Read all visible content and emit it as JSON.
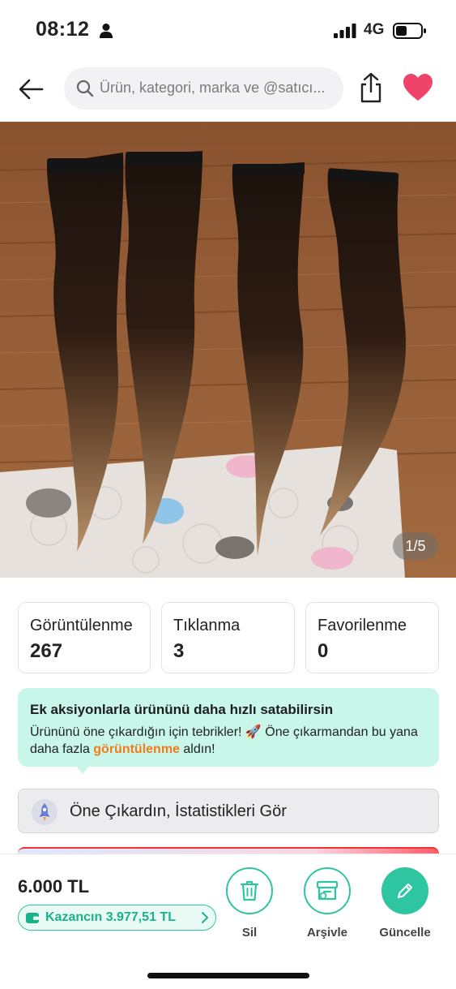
{
  "status_bar": {
    "time": "08:12",
    "network": "4G"
  },
  "header": {
    "search_placeholder": "Ürün, kategori, marka ve @satıcı...",
    "favorited": true,
    "heart_color": "#f0436a"
  },
  "gallery": {
    "counter": "1/5",
    "current_index": 1,
    "total": 5
  },
  "stats": [
    {
      "label": "Görüntülenme",
      "value": "267"
    },
    {
      "label": "Tıklanma",
      "value": "3"
    },
    {
      "label": "Favorilenme",
      "value": "0"
    }
  ],
  "promo": {
    "title": "Ek aksiyonlarla ürününü daha hızlı satabilirsin",
    "text_before": "Ürününü öne çıkardığın için tebrikler! 🚀 Öne çıkarmandan bu yana daha fazla ",
    "text_highlight": "görüntülenme",
    "text_after": " aldın!",
    "highlight_color": "#f27a1a",
    "background_color": "#c8f7e9"
  },
  "feature_button": {
    "label": "Öne Çıkardın, İstatistikleri Gör"
  },
  "bottom_bar": {
    "price": "6.000 TL",
    "earnings": "Kazancın 3.977,51 TL",
    "actions": [
      {
        "label": "Sil",
        "icon": "trash-icon"
      },
      {
        "label": "Arşivle",
        "icon": "archive-icon"
      },
      {
        "label": "Güncelle",
        "icon": "pencil-icon"
      }
    ],
    "accent_color": "#2ec6a0"
  }
}
